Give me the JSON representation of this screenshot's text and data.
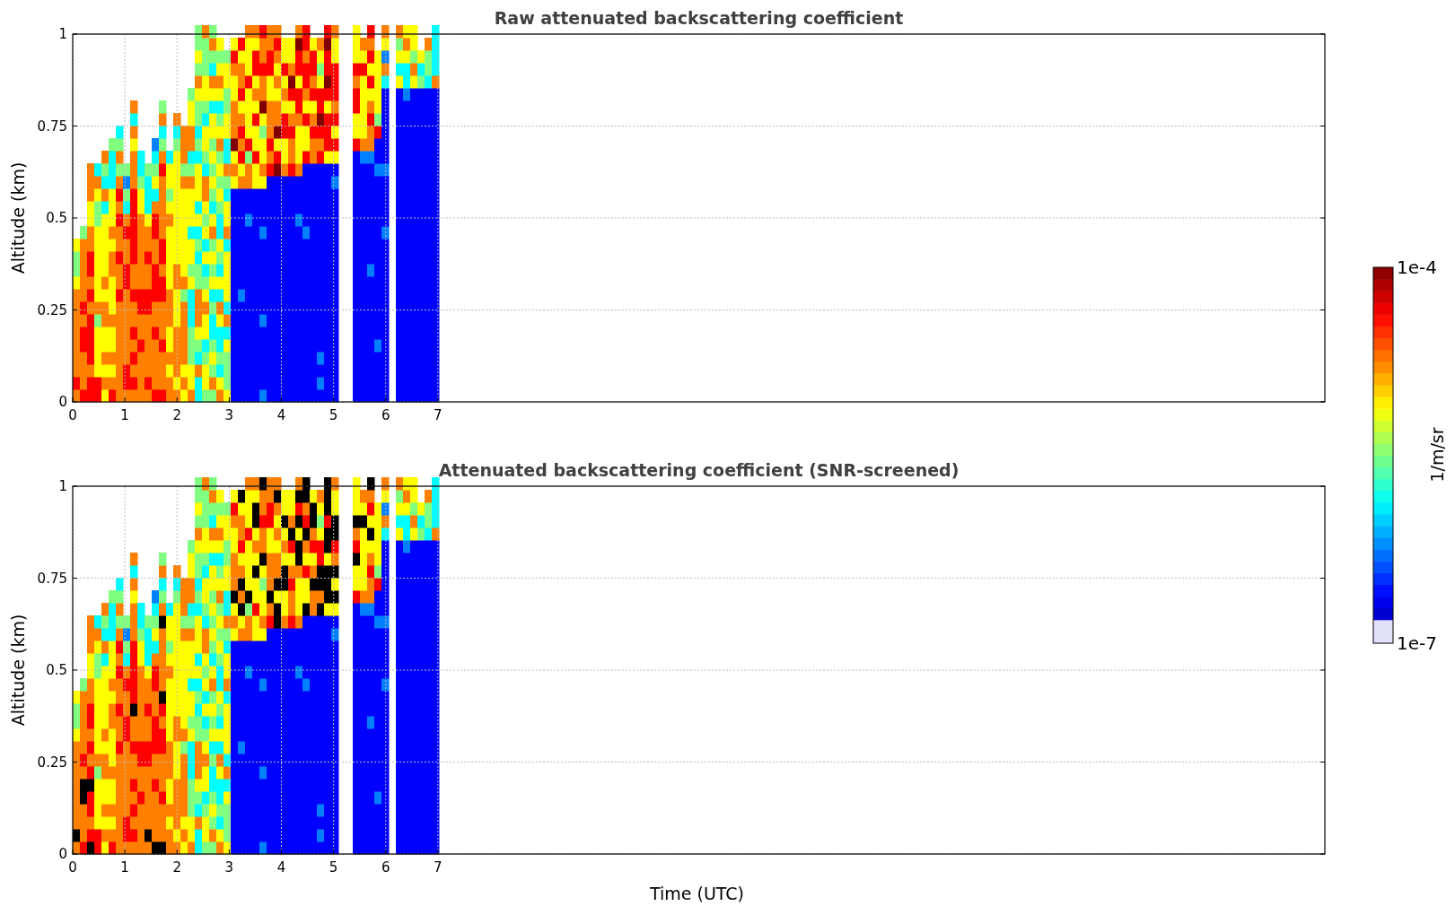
{
  "panels": [
    {
      "title": "Raw attenuated backscattering coefficient",
      "ylabel": "Altitude (km)",
      "screened": false,
      "xticks": [
        "0",
        "1",
        "2",
        "3",
        "4",
        "5",
        "6",
        "7"
      ],
      "yticks": [
        "1",
        "0.75",
        "0.5",
        "0.25",
        "0"
      ]
    },
    {
      "title": "Attenuated backscattering coefficient (SNR-screened)",
      "ylabel": "Altitude (km)",
      "screened": true,
      "xticks": [
        "0",
        "1",
        "2",
        "3",
        "4",
        "5",
        "6",
        "7"
      ],
      "yticks": [
        "1",
        "0.75",
        "0.5",
        "0.25",
        "0"
      ]
    }
  ],
  "xlabel": "Time (UTC)",
  "colorbar": {
    "max": "1e-4",
    "min": "1e-7",
    "label": "1/m/sr"
  }
}
